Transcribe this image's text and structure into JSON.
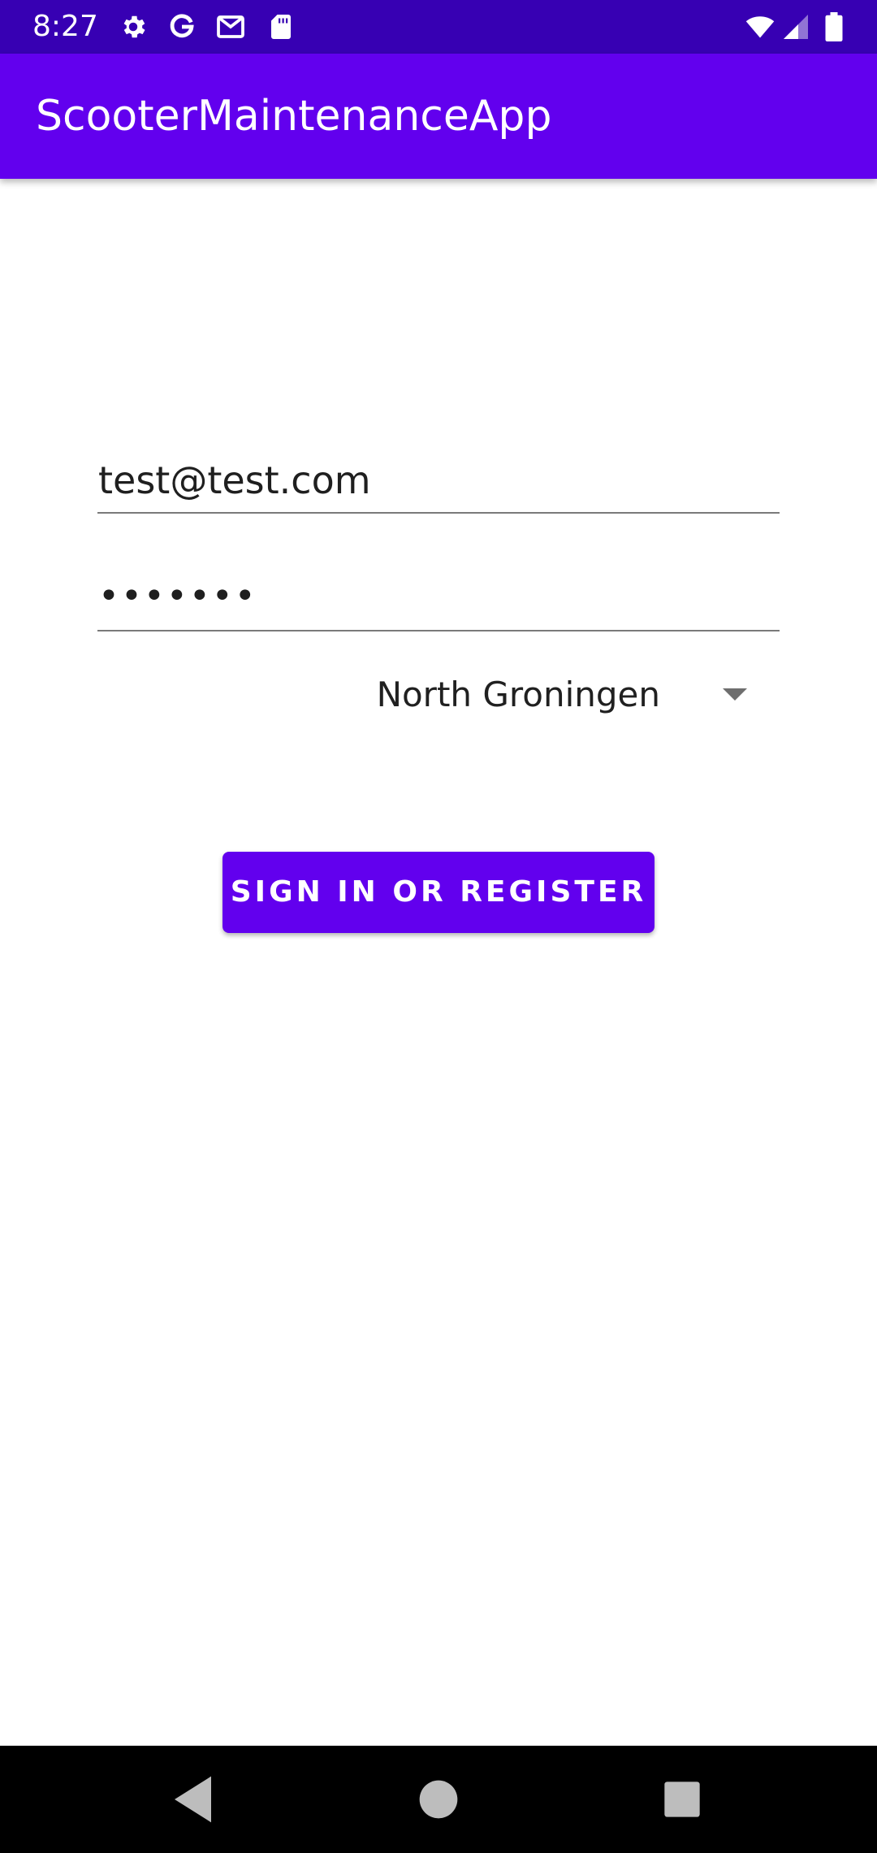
{
  "status_bar": {
    "time": "8:27",
    "icons_left": [
      "settings-icon",
      "google-icon",
      "gmail-icon",
      "sd-card-icon"
    ],
    "icons_right": [
      "wifi-icon",
      "cell-signal-icon",
      "battery-icon"
    ]
  },
  "app_bar": {
    "title": "ScooterMaintenanceApp",
    "color": "#6200ee"
  },
  "form": {
    "email_value": "test@test.com",
    "password_value": "•••••••",
    "region_selected": "North Groningen",
    "submit_label": "SIGN IN OR REGISTER"
  },
  "nav_bar": {
    "buttons": [
      "back-icon",
      "home-icon",
      "recents-icon"
    ]
  },
  "colors": {
    "primary": "#6200ee",
    "primary_dark": "#3700b3",
    "nav_background": "#000000"
  }
}
